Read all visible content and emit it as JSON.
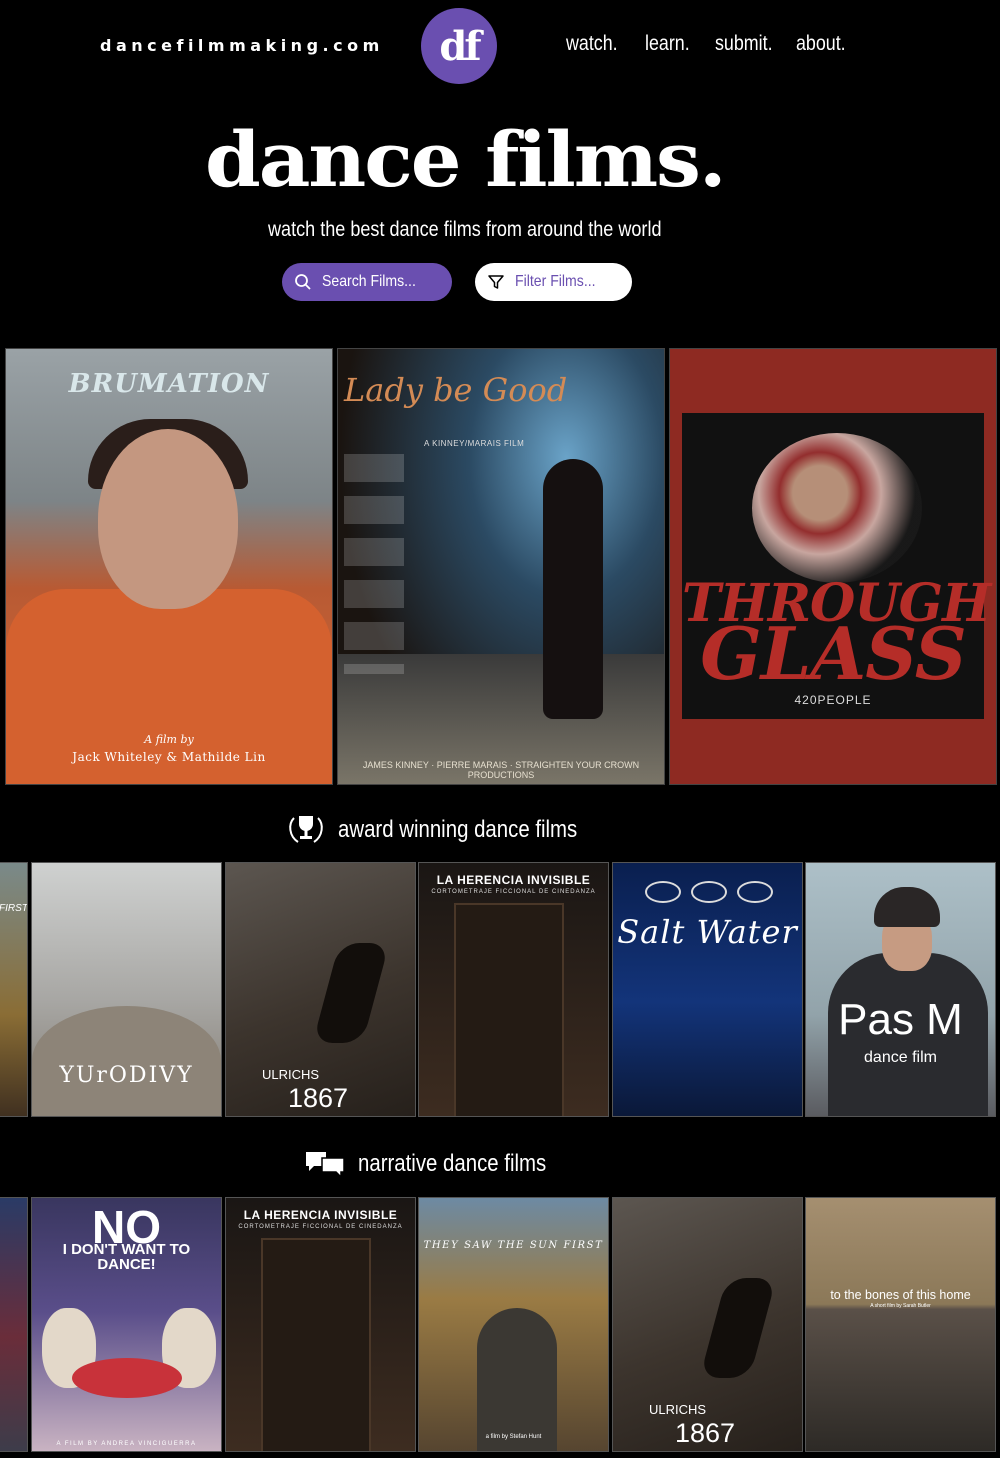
{
  "header": {
    "site_url": "dancefilmmaking.com",
    "logo_text": "df",
    "nav": [
      "watch.",
      "learn.",
      "submit.",
      "about."
    ]
  },
  "hero": {
    "title": "dance films.",
    "subtitle": "watch the best dance films from around the world",
    "search_label": "Search Films...",
    "filter_label": "Filter Films..."
  },
  "featured": [
    {
      "title": "BRUMATION",
      "credit_prefix": "A film by",
      "credit": "Jack Whiteley & Mathilde Lin"
    },
    {
      "title": "Lady be Good",
      "byline": "A KINNEY/MARAIS FILM",
      "credits": "JAMES KINNEY · PIERRE MARAIS · STRAIGHTEN YOUR CROWN PRODUCTIONS"
    },
    {
      "title_line1": "THROUGH",
      "title_line2": "GLASS",
      "company": "420PEOPLE"
    }
  ],
  "sections": [
    {
      "icon": "trophy-icon",
      "title": "award winning dance films",
      "posters": [
        {
          "title": "FIRST"
        },
        {
          "title": "YUrODIVY"
        },
        {
          "title_line1": "ULRICHS",
          "title_line2": "1867"
        },
        {
          "title": "LA HERENCIA INVISIBLE",
          "subtitle": "CORTOMETRAJE FICCIONAL DE CINEDANZA"
        },
        {
          "title": "Salt Water"
        },
        {
          "title": "Pas M",
          "subtitle": "dance film"
        }
      ]
    },
    {
      "icon": "speech-bubbles-icon",
      "title": "narrative dance films",
      "posters": [
        {
          "title": ""
        },
        {
          "title_line1": "NO",
          "title_line2": "I DON'T WANT TO DANCE!",
          "credit": "A FILM BY ANDREA VINCIGUERRA"
        },
        {
          "title": "LA HERENCIA INVISIBLE",
          "subtitle": "CORTOMETRAJE FICCIONAL DE CINEDANZA"
        },
        {
          "title": "THEY SAW THE SUN FIRST",
          "credit": "a film by Stefan Hunt"
        },
        {
          "title_line1": "ULRICHS",
          "title_line2": "1867"
        },
        {
          "title": "to the bones of this home",
          "subtitle": "A short film by Sarah Butler"
        }
      ]
    }
  ],
  "colors": {
    "accent": "#6a4fb0",
    "background": "#000000",
    "text": "#ffffff"
  }
}
